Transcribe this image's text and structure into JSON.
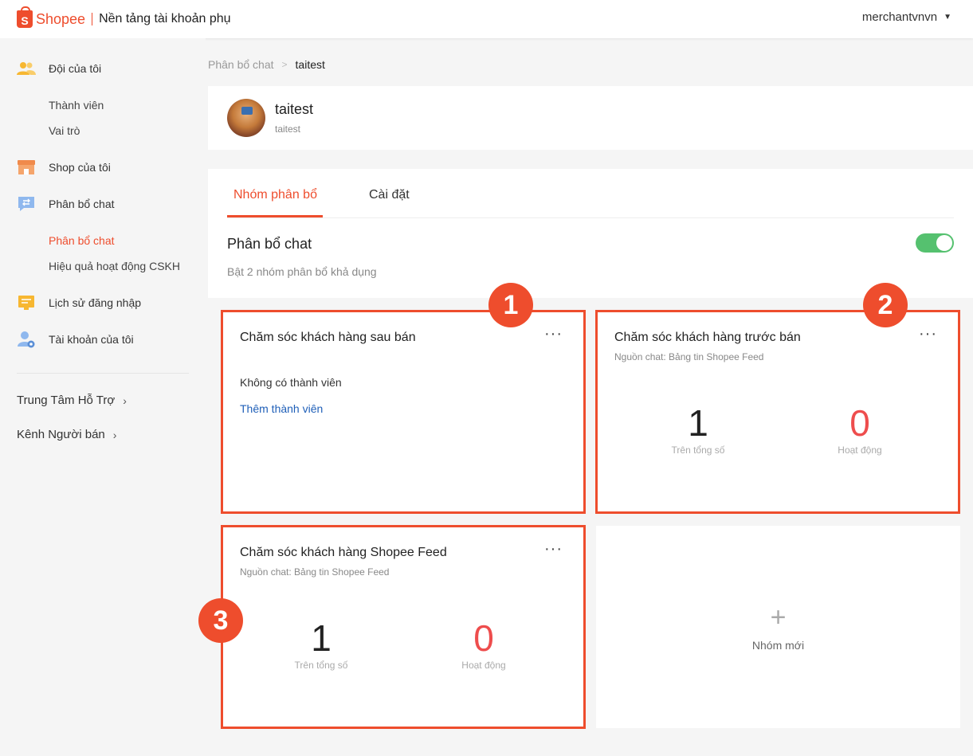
{
  "header": {
    "brand": "Shopee",
    "portal_title": "Nền tảng tài khoản phụ",
    "username": "merchantvnvn"
  },
  "sidebar": {
    "sections": [
      {
        "label": "Đội của tôi",
        "icon": "team-icon",
        "children": [
          "Thành viên",
          "Vai trò"
        ]
      },
      {
        "label": "Shop của tôi",
        "icon": "shop-icon",
        "children": []
      },
      {
        "label": "Phân bổ chat",
        "icon": "chat-assign-icon",
        "children": [
          "Phân bổ chat",
          "Hiệu quả hoạt động CSKH"
        ]
      },
      {
        "label": "Lịch sử đăng nhập",
        "icon": "login-history-icon",
        "children": []
      },
      {
        "label": "Tài khoản của tôi",
        "icon": "account-icon",
        "children": []
      }
    ],
    "active_child": "Phân bổ chat",
    "links": [
      "Trung Tâm Hỗ Trợ",
      "Kênh Người bán"
    ]
  },
  "breadcrumb": {
    "parent": "Phân bổ chat",
    "current": "taitest"
  },
  "profile": {
    "name": "taitest",
    "subtitle": "taitest"
  },
  "tabs": [
    {
      "label": "Nhóm phân bổ",
      "active": true
    },
    {
      "label": "Cài đặt",
      "active": false
    }
  ],
  "section": {
    "title": "Phân bổ chat",
    "description": "Bật 2 nhóm phân bổ khả dụng",
    "toggle_on": true
  },
  "groups": [
    {
      "badge": "1",
      "title": "Chăm sóc khách hàng sau bán",
      "empty_text": "Không có thành viên",
      "add_link": "Thêm thành viên"
    },
    {
      "badge": "2",
      "title": "Chăm sóc khách hàng trước bán",
      "source": "Nguồn chat: Bảng tin Shopee Feed",
      "total": "1",
      "total_label": "Trên tổng số",
      "active": "0",
      "active_label": "Hoạt động"
    },
    {
      "badge": "3",
      "title": "Chăm sóc khách hàng Shopee Feed",
      "source": "Nguồn chat: Bảng tin Shopee Feed",
      "total": "1",
      "total_label": "Trên tổng số",
      "active": "0",
      "active_label": "Hoạt động"
    }
  ],
  "new_group": {
    "label": "Nhóm mới"
  },
  "colors": {
    "accent": "#ee4d2d",
    "toggle": "#55c16f",
    "link": "#1f5fb8"
  }
}
